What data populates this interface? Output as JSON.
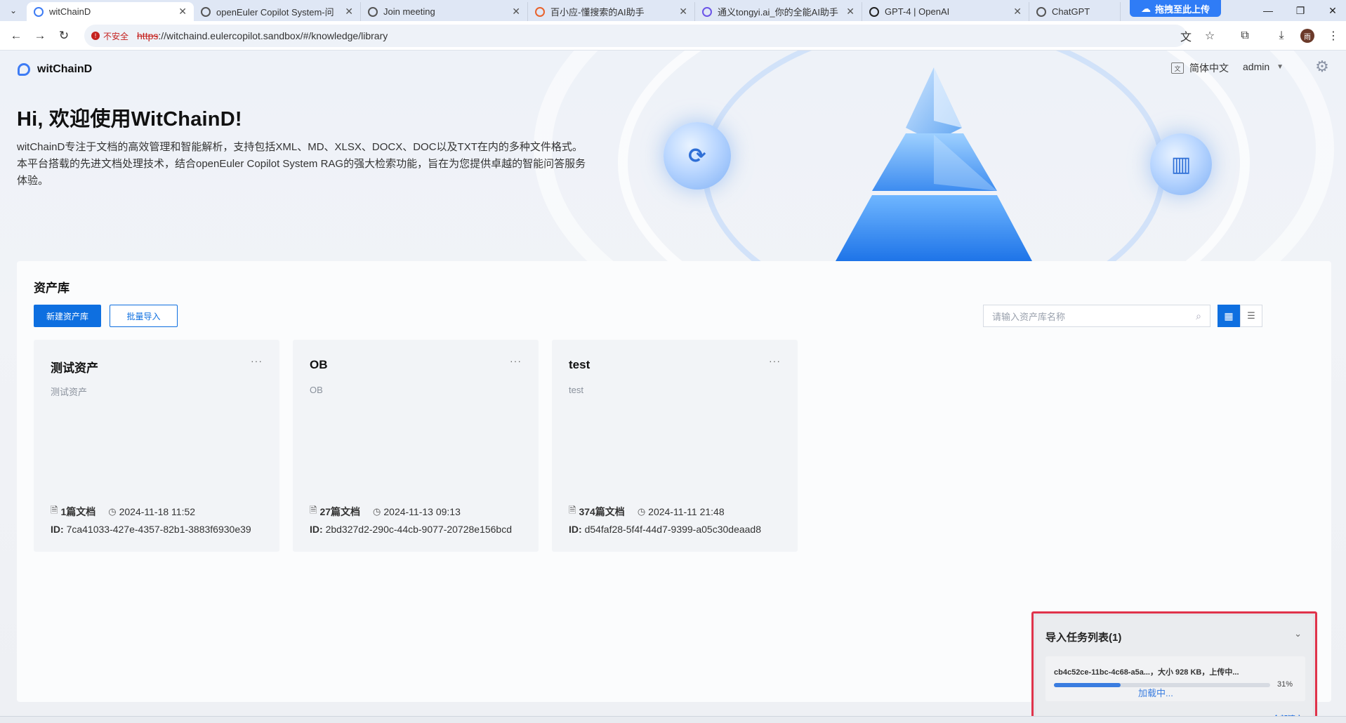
{
  "browser": {
    "tabs": [
      {
        "title": "witChainD",
        "active": true,
        "color": "#3e7cf4"
      },
      {
        "title": "openEuler Copilot System-问",
        "active": false,
        "color": "#555555"
      },
      {
        "title": "Join meeting",
        "active": false,
        "color": "#555555"
      },
      {
        "title": "百小应-懂搜索的AI助手",
        "active": false,
        "color": "#e8622c"
      },
      {
        "title": "通义tongyi.ai_你的全能AI助手",
        "active": false,
        "color": "#6c55e8"
      },
      {
        "title": "GPT-4 | OpenAI",
        "active": false,
        "color": "#222222"
      },
      {
        "title": "ChatGPT",
        "active": false,
        "color": "#555555"
      }
    ],
    "upload_pill": "拖拽至此上传",
    "security_label": "不安全",
    "url_scheme": "https",
    "url_rest": "://witchaind.eulercopilot.sandbox/#/knowledge/library",
    "profile_initial": "雨"
  },
  "header": {
    "app_name": "witChainD",
    "language": "简体中文",
    "user": "admin"
  },
  "hero": {
    "title": "Hi, 欢迎使用WitChainD!",
    "description": "witChainD专注于文档的高效管理和智能解析，支持包括XML、MD、XLSX、DOCX、DOC以及TXT在内的多种文件格式。本平台搭载的先进文档处理技术，结合openEuler Copilot System RAG的强大检索功能，旨在为您提供卓越的智能问答服务体验。"
  },
  "library": {
    "title": "资产库",
    "new_button": "新建资产库",
    "import_button": "批量导入",
    "search_placeholder": "请输入资产库名称",
    "cards": [
      {
        "name": "测试资产",
        "desc": "测试资产",
        "docs": "1篇文档",
        "date": "2024-11-18 11:52",
        "id_label": "ID:",
        "id": "7ca41033-427e-4357-82b1-3883f6930e39"
      },
      {
        "name": "OB",
        "desc": "OB",
        "docs": "27篇文档",
        "date": "2024-11-13 09:13",
        "id_label": "ID:",
        "id": "2bd327d2-290c-44cb-9077-20728e156bcd"
      },
      {
        "name": "test",
        "desc": "test",
        "docs": "374篇文档",
        "date": "2024-11-11 21:48",
        "id_label": "ID:",
        "id": "d54faf28-5f4f-44d7-9399-a05c30deaad8"
      }
    ],
    "more_label": "···"
  },
  "task_panel": {
    "title": "导入任务列表(1)",
    "item_text": "cb4c52ce-11bc-4c68-a5a...，大小 928 KB，上传中...",
    "progress_percent": 31,
    "progress_label": "31%",
    "loading_label": "加载中...",
    "clear_all": "全部清空"
  }
}
